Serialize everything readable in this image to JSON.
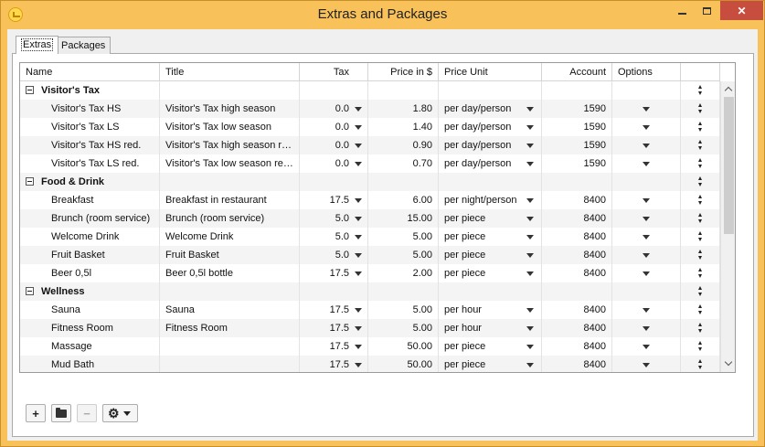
{
  "window": {
    "title": "Extras and Packages"
  },
  "tabs": [
    {
      "label": "Extras",
      "active": true
    },
    {
      "label": "Packages",
      "active": false
    }
  ],
  "columns": [
    "Name",
    "Title",
    "Tax",
    "Price in $",
    "Price Unit",
    "Account",
    "Options"
  ],
  "rows": [
    {
      "type": "group",
      "name": "Visitor's Tax"
    },
    {
      "type": "item",
      "name": "Visitor's Tax HS",
      "title": "Visitor's Tax high season",
      "tax": "0.0",
      "price": "1.80",
      "unit": "per day/person",
      "account": "1590"
    },
    {
      "type": "item",
      "name": "Visitor's Tax LS",
      "title": "Visitor's Tax low season",
      "tax": "0.0",
      "price": "1.40",
      "unit": "per day/person",
      "account": "1590"
    },
    {
      "type": "item",
      "name": "Visitor's Tax HS red.",
      "title": "Visitor's Tax high season re...",
      "tax": "0.0",
      "price": "0.90",
      "unit": "per day/person",
      "account": "1590"
    },
    {
      "type": "item",
      "name": "Visitor's Tax LS red.",
      "title": "Visitor's Tax low season red...",
      "tax": "0.0",
      "price": "0.70",
      "unit": "per day/person",
      "account": "1590"
    },
    {
      "type": "group",
      "name": "Food & Drink"
    },
    {
      "type": "item",
      "name": "Breakfast",
      "title": "Breakfast in restaurant",
      "tax": "17.5",
      "price": "6.00",
      "unit": "per night/person",
      "account": "8400"
    },
    {
      "type": "item",
      "name": "Brunch (room service)",
      "title": "Brunch (room service)",
      "tax": "5.0",
      "price": "15.00",
      "unit": "per piece",
      "account": "8400"
    },
    {
      "type": "item",
      "name": "Welcome Drink",
      "title": "Welcome Drink",
      "tax": "5.0",
      "price": "5.00",
      "unit": "per piece",
      "account": "8400"
    },
    {
      "type": "item",
      "name": "Fruit Basket",
      "title": "Fruit Basket",
      "tax": "5.0",
      "price": "5.00",
      "unit": "per piece",
      "account": "8400"
    },
    {
      "type": "item",
      "name": "Beer 0,5l",
      "title": "Beer 0,5l bottle",
      "tax": "17.5",
      "price": "2.00",
      "unit": "per piece",
      "account": "8400"
    },
    {
      "type": "group",
      "name": "Wellness"
    },
    {
      "type": "item",
      "name": "Sauna",
      "title": "Sauna",
      "tax": "17.5",
      "price": "5.00",
      "unit": "per hour",
      "account": "8400"
    },
    {
      "type": "item",
      "name": "Fitness Room",
      "title": "Fitness Room",
      "tax": "17.5",
      "price": "5.00",
      "unit": "per hour",
      "account": "8400"
    },
    {
      "type": "item",
      "name": "Massage",
      "title": "",
      "tax": "17.5",
      "price": "50.00",
      "unit": "per piece",
      "account": "8400"
    },
    {
      "type": "item",
      "name": "Mud Bath",
      "title": "",
      "tax": "17.5",
      "price": "50.00",
      "unit": "per piece",
      "account": "8400"
    }
  ],
  "toolbar": {
    "add_label": "+",
    "remove_label": "−",
    "gear_glyph": "⚙"
  },
  "icons": [
    "app-icon",
    "minimize-icon",
    "maximize-icon",
    "close-icon",
    "expander-icon",
    "dropdown-arrow-icon",
    "sort-updown-icon",
    "folder-icon",
    "gear-icon"
  ],
  "colors": {
    "window_frame": "#f8c15a",
    "close_button": "#c74d3f",
    "alt_row": "#f4f4f4"
  }
}
